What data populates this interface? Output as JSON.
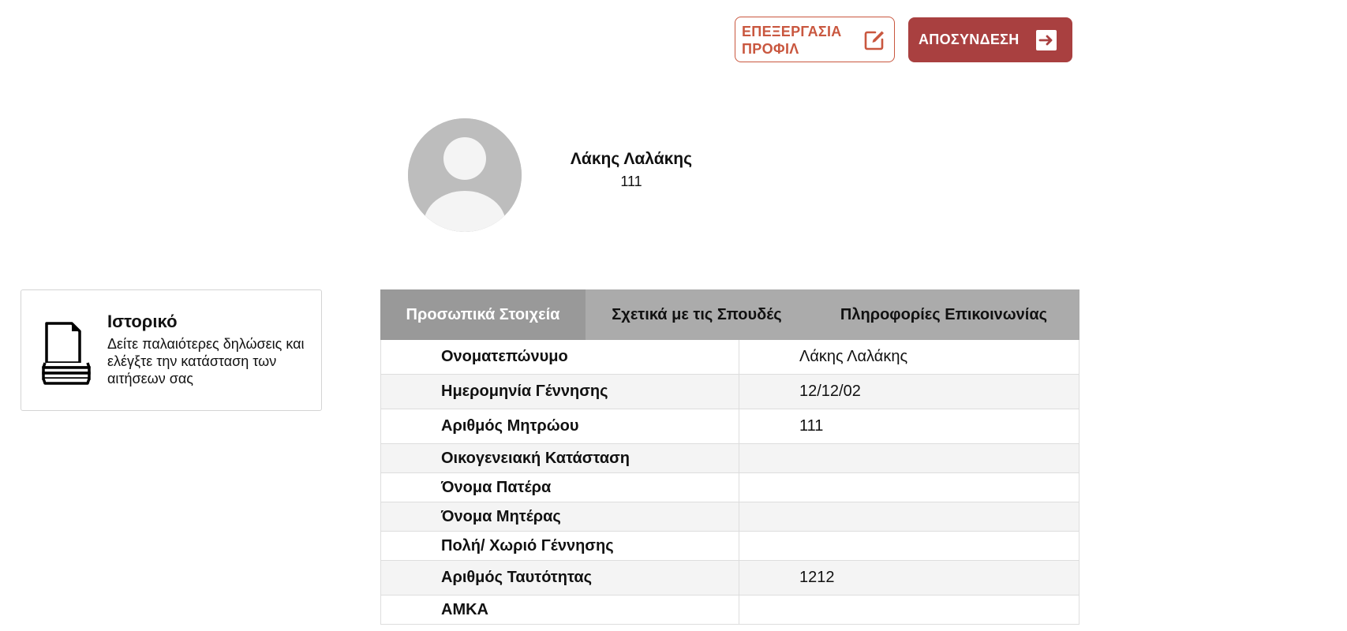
{
  "header": {
    "edit_profile_label": "ΕΠΕΞΕΡΓΑΣΙΑ ΠΡΟΦΙΛ",
    "logout_label": "ΑΠΟΣΥΝΔΕΣΗ",
    "accent_color": "#c9573f",
    "logout_color": "#a94040"
  },
  "profile": {
    "name": "Λάκης Λαλάκης",
    "id": "111"
  },
  "history": {
    "title": "Ιστορικό",
    "description": "Δείτε παλαιότερες δηλώσεις και ελέγξτε την κατάσταση των αιτήσεων σας"
  },
  "tabs": [
    {
      "label": "Προσωπικά Στοιχεία",
      "active": true
    },
    {
      "label": "Σχετικά με τις Σπουδές",
      "active": false
    },
    {
      "label": "Πληροφορίες Επικοινωνίας",
      "active": false
    }
  ],
  "personal_info": {
    "rows": [
      {
        "label": "Ονοματεπώνυμο",
        "value": "Λάκης Λαλάκης"
      },
      {
        "label": "Ημερομηνία Γέννησης",
        "value": "12/12/02"
      },
      {
        "label": "Αριθμός Μητρώου",
        "value": "111"
      },
      {
        "label": "Οικογενειακή Κατάσταση",
        "value": ""
      },
      {
        "label": "Όνομα Πατέρα",
        "value": ""
      },
      {
        "label": "Όνομα Μητέρας",
        "value": ""
      },
      {
        "label": "Πολή/ Χωριό Γέννησης",
        "value": ""
      },
      {
        "label": "Αριθμός Ταυτότητας",
        "value": "1212"
      },
      {
        "label": "ΑΜΚΑ",
        "value": ""
      }
    ]
  }
}
